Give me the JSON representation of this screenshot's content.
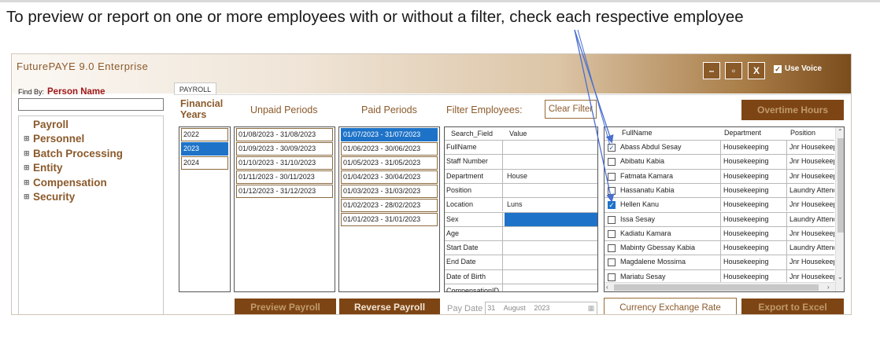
{
  "caption": "To preview or report on one or more employees with or without a filter, check each respective employee",
  "app": {
    "title": "FuturePAYE 9.0 Enterprise",
    "window_buttons": [
      "–",
      "▫",
      "X"
    ],
    "use_voice": {
      "label": "Use Voice",
      "checked": true
    }
  },
  "find": {
    "label": "Find By:",
    "value": "Person Name",
    "input_value": ""
  },
  "tree": [
    "Payroll",
    "Personnel",
    "Batch Processing",
    "Entity",
    "Compensation",
    "Security"
  ],
  "tab": "PAYROLL",
  "financial_years": {
    "label_line1": "Financial",
    "label_line2": "Years",
    "items": [
      "2022",
      "2023",
      "2024"
    ],
    "selected": "2023"
  },
  "unpaid_periods": {
    "label": "Unpaid Periods",
    "items": [
      "01/08/2023 - 31/08/2023",
      "01/09/2023 - 30/09/2023",
      "01/10/2023 - 31/10/2023",
      "01/11/2023 - 30/11/2023",
      "01/12/2023 - 31/12/2023"
    ]
  },
  "paid_periods": {
    "label": "Paid Periods",
    "items": [
      "01/07/2023 - 31/07/2023",
      "01/06/2023 - 30/06/2023",
      "01/05/2023 - 31/05/2023",
      "01/04/2023 - 30/04/2023",
      "01/03/2023 - 31/03/2023",
      "01/02/2023 - 28/02/2023",
      "01/01/2023 - 31/01/2023"
    ],
    "selected": "01/07/2023 - 31/07/2023"
  },
  "filter": {
    "label": "Filter Employees:",
    "clear_label": "Clear Filter",
    "header_field": "Search_Field",
    "header_value": "Value",
    "rows": [
      {
        "field": "FullName",
        "value": ""
      },
      {
        "field": "Staff Number",
        "value": ""
      },
      {
        "field": "Department",
        "value": "House"
      },
      {
        "field": "Position",
        "value": ""
      },
      {
        "field": "Location",
        "value": "Luns"
      },
      {
        "field": "Sex",
        "value": ""
      },
      {
        "field": "Age",
        "value": ""
      },
      {
        "field": "Start Date",
        "value": ""
      },
      {
        "field": "End Date",
        "value": ""
      },
      {
        "field": "Date of Birth",
        "value": ""
      },
      {
        "field": "CompensationID",
        "value": ""
      }
    ]
  },
  "overtime_label": "Overtime Hours",
  "employees": {
    "headers": [
      "FullName",
      "Department",
      "Position"
    ],
    "rows": [
      {
        "name": "Abass Abdul Sesay",
        "dept": "Housekeeping",
        "pos": "Jnr Housekeeper",
        "checked": true
      },
      {
        "name": "Abibatu Kabia",
        "dept": "Housekeeping",
        "pos": "Jnr Housekeeper",
        "checked": false
      },
      {
        "name": "Fatmata Kamara",
        "dept": "Housekeeping",
        "pos": "Jnr Housekeeper",
        "checked": false
      },
      {
        "name": "Hassanatu Kabia",
        "dept": "Housekeeping",
        "pos": "Laundry Attendant",
        "checked": false
      },
      {
        "name": "Hellen Kanu",
        "dept": "Housekeeping",
        "pos": "Jnr Housekeeper",
        "checked": true
      },
      {
        "name": "Issa Sesay",
        "dept": "Housekeeping",
        "pos": "Laundry Attendant",
        "checked": false
      },
      {
        "name": "Kadiatu Kamara",
        "dept": "Housekeeping",
        "pos": "Jnr Housekeeper",
        "checked": false
      },
      {
        "name": "Mabinty Gbessay Kabia",
        "dept": "Housekeeping",
        "pos": "Laundry Attendant",
        "checked": false
      },
      {
        "name": "Magdalene Mossima",
        "dept": "Housekeeping",
        "pos": "Jnr Housekeeper",
        "checked": false
      },
      {
        "name": "Mariatu Sesay",
        "dept": "Housekeeping",
        "pos": "Jnr Housekeeper",
        "checked": false
      }
    ]
  },
  "buttons": {
    "preview": "Preview Payroll",
    "reverse": "Reverse Payroll",
    "currency": "Currency Exchange Rate",
    "export": "Export to Excel"
  },
  "pay_date": {
    "label": "Pay Date",
    "day": "31",
    "month": "August",
    "year": "2023"
  },
  "colors": {
    "accent_brown": "#7e4514",
    "label_brown": "#8b5a2b",
    "selection_blue": "#1e73c8",
    "arrow_blue": "#4a6fd0"
  }
}
